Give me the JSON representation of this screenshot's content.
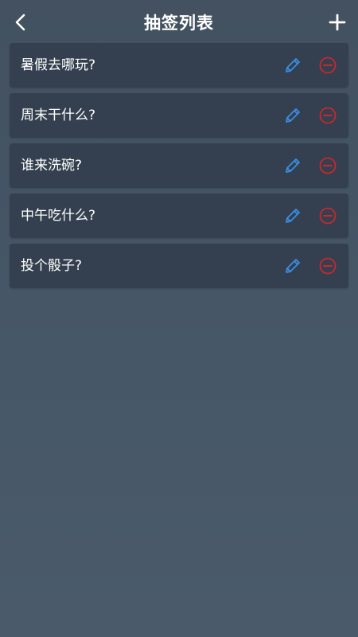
{
  "header": {
    "title": "抽签列表",
    "back_icon": "chevron-left-icon",
    "add_icon": "plus-icon"
  },
  "items": [
    {
      "label": "暑假去哪玩?"
    },
    {
      "label": "周末干什么?"
    },
    {
      "label": "谁来洗碗?"
    },
    {
      "label": "中午吃什么?"
    },
    {
      "label": "投个骰子?"
    }
  ],
  "icons": {
    "edit": "pencil-icon",
    "delete": "minus-circle-icon"
  },
  "colors": {
    "background": "#455565",
    "card": "#34404f",
    "edit_accent": "#3a8ee6",
    "delete_accent": "#c8282e",
    "text": "#ffffff"
  }
}
